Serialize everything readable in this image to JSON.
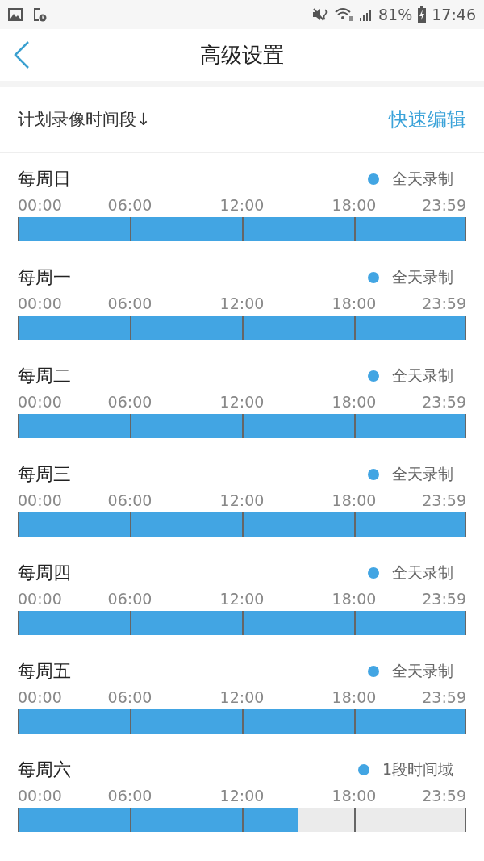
{
  "status_bar": {
    "battery": "81%",
    "time": "17:46"
  },
  "header": {
    "title": "高级设置"
  },
  "section": {
    "label": "计划录像时间段↓",
    "action": "快速编辑"
  },
  "days": [
    {
      "name": "每周日",
      "status": "全天录制",
      "ticks": [
        "00:00",
        "06:00",
        "12:00",
        "18:00",
        "23:59"
      ],
      "level": 1
    },
    {
      "name": "每周一",
      "status": "全天录制",
      "ticks": [
        "00:00",
        "06:00",
        "12:00",
        "18:00",
        "23:59"
      ],
      "level": 1
    },
    {
      "name": "每周二",
      "status": "全天录制",
      "ticks": [
        "00:00",
        "06:00",
        "12:00",
        "18:00",
        "23:59"
      ],
      "level": 1
    },
    {
      "name": "每周三",
      "status": "全天录制",
      "ticks": [
        "00:00",
        "06:00",
        "12:00",
        "18:00",
        "23:59"
      ],
      "level": 1
    },
    {
      "name": "每周四",
      "status": "全天录制",
      "ticks": [
        "00:00",
        "06:00",
        "12:00",
        "18:00",
        "23:59"
      ],
      "level": 1
    },
    {
      "name": "每周五",
      "status": "全天录制",
      "ticks": [
        "00:00",
        "06:00",
        "12:00",
        "18:00",
        "23:59"
      ],
      "level": 1
    },
    {
      "name": "每周六",
      "status": "1段时间域",
      "ticks": [
        "00:00",
        "06:00",
        "12:00",
        "18:00",
        "23:59"
      ],
      "level": 0.625
    }
  ]
}
